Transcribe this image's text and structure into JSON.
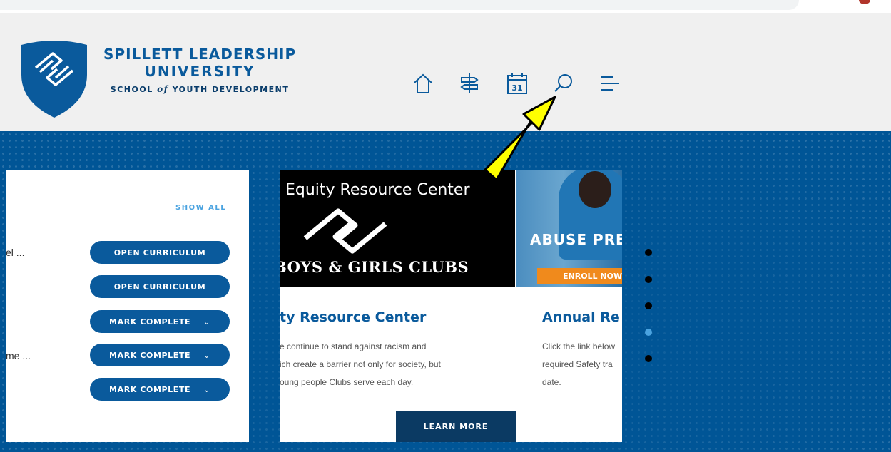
{
  "brand": {
    "line1": "SPILLETT LEADERSHIP",
    "line2": "UNIVERSITY",
    "line3_a": "SCHOOL",
    "line3_of": "of",
    "line3_b": "YOUTH DEVELOPMENT"
  },
  "nav": {
    "icons": [
      "home-icon",
      "signpost-icon",
      "calendar-icon",
      "search-icon",
      "menu-icon"
    ],
    "calendar_day": "31"
  },
  "curriculum": {
    "show_all": "SHOW ALL",
    "rows": [
      {
        "text": "el ...",
        "button": "OPEN CURRICULUM",
        "has_chevron": false
      },
      {
        "text": "",
        "button": "OPEN CURRICULUM",
        "has_chevron": false
      },
      {
        "text": "",
        "button": "MARK COMPLETE",
        "has_chevron": true
      },
      {
        "text": "me ...",
        "button": "MARK COMPLETE",
        "has_chevron": true
      },
      {
        "text": "",
        "button": "MARK COMPLETE",
        "has_chevron": true
      }
    ]
  },
  "slider": {
    "slide1": {
      "image_title": "Equity Resource Center",
      "image_caption": "BOYS & GIRLS CLUBS",
      "heading": "ty Resource Center",
      "lines": [
        "e continue to stand against racism and",
        "ich create a barrier not only for society, but",
        "oung people Clubs serve each day."
      ],
      "button": "LEARN MORE"
    },
    "slide2": {
      "image_text": "ABUSE PREV",
      "image_badge": "ENROLL NOW!",
      "heading": "Annual Re",
      "lines": [
        "Click the link below",
        "required Safety tra",
        "date."
      ]
    },
    "dots": 5,
    "active_dot": 4
  },
  "colors": {
    "brand_blue": "#0a5a9c",
    "light_blue": "#4aa3e0",
    "dark_navy": "#0b3a63",
    "highlight_arrow": "#ffff00"
  }
}
